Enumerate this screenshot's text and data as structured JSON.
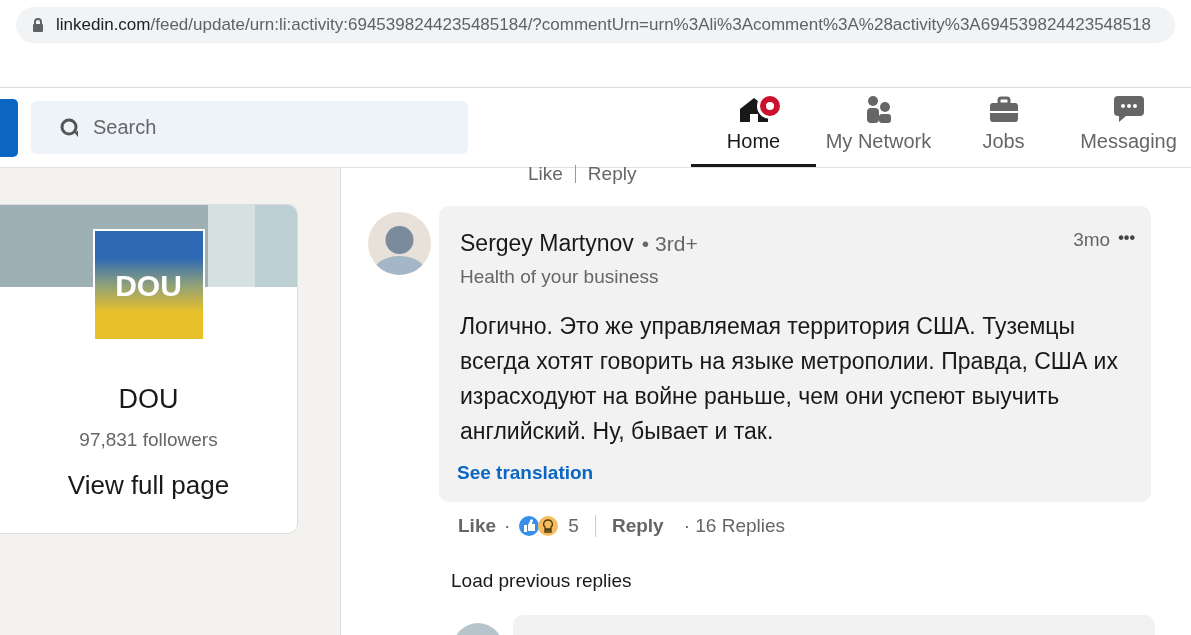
{
  "browser": {
    "url_domain": "linkedin.com",
    "url_path": "/feed/update/urn:li:activity:6945398244235485184/?commentUrn=urn%3Ali%3Acomment%3A%28activity%3A694539824423548518"
  },
  "header": {
    "search": {
      "placeholder": "Search"
    },
    "nav": [
      {
        "label": "Home",
        "kind": "home",
        "selected": true,
        "badge": true
      },
      {
        "label": "My Network",
        "kind": "network",
        "selected": false,
        "badge": false
      },
      {
        "label": "Jobs",
        "kind": "jobs",
        "selected": false,
        "badge": false
      },
      {
        "label": "Messaging",
        "kind": "messaging",
        "selected": false,
        "badge": false
      }
    ]
  },
  "company_card": {
    "logo_text": "DOU",
    "name": "DOU",
    "followers": "97,831 followers",
    "link": "View full page"
  },
  "previous_actions": {
    "like": "Like",
    "reply": "Reply"
  },
  "comment": {
    "author": "Sergey Martynov",
    "degree": "• 3rd+",
    "headline": "Health of your business",
    "time": "3mo",
    "more": "•••",
    "text": "Логично. Это же управляемая территория США. Туземцы всегда хотят говорить на языке метрополии. Правда, США их израсходуют на войне раньше, чем они успеют выучить английский. Ну, бывает и так.",
    "translate": "See translation",
    "like": "Like",
    "separator": "·",
    "reaction_count": "5",
    "reply": "Reply",
    "replies": "· 16 Replies"
  },
  "load_previous": "Load previous replies"
}
